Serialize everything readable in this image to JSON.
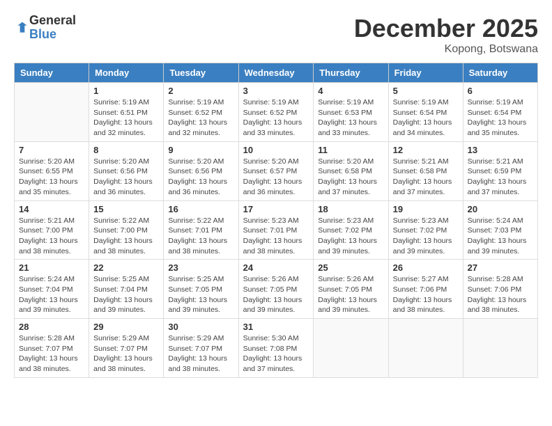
{
  "logo": {
    "general": "General",
    "blue": "Blue"
  },
  "title": "December 2025",
  "location": "Kopong, Botswana",
  "days_of_week": [
    "Sunday",
    "Monday",
    "Tuesday",
    "Wednesday",
    "Thursday",
    "Friday",
    "Saturday"
  ],
  "weeks": [
    [
      {
        "day": "",
        "info": ""
      },
      {
        "day": "1",
        "info": "Sunrise: 5:19 AM\nSunset: 6:51 PM\nDaylight: 13 hours\nand 32 minutes."
      },
      {
        "day": "2",
        "info": "Sunrise: 5:19 AM\nSunset: 6:52 PM\nDaylight: 13 hours\nand 32 minutes."
      },
      {
        "day": "3",
        "info": "Sunrise: 5:19 AM\nSunset: 6:52 PM\nDaylight: 13 hours\nand 33 minutes."
      },
      {
        "day": "4",
        "info": "Sunrise: 5:19 AM\nSunset: 6:53 PM\nDaylight: 13 hours\nand 33 minutes."
      },
      {
        "day": "5",
        "info": "Sunrise: 5:19 AM\nSunset: 6:54 PM\nDaylight: 13 hours\nand 34 minutes."
      },
      {
        "day": "6",
        "info": "Sunrise: 5:19 AM\nSunset: 6:54 PM\nDaylight: 13 hours\nand 35 minutes."
      }
    ],
    [
      {
        "day": "7",
        "info": "Sunrise: 5:20 AM\nSunset: 6:55 PM\nDaylight: 13 hours\nand 35 minutes."
      },
      {
        "day": "8",
        "info": "Sunrise: 5:20 AM\nSunset: 6:56 PM\nDaylight: 13 hours\nand 36 minutes."
      },
      {
        "day": "9",
        "info": "Sunrise: 5:20 AM\nSunset: 6:56 PM\nDaylight: 13 hours\nand 36 minutes."
      },
      {
        "day": "10",
        "info": "Sunrise: 5:20 AM\nSunset: 6:57 PM\nDaylight: 13 hours\nand 36 minutes."
      },
      {
        "day": "11",
        "info": "Sunrise: 5:20 AM\nSunset: 6:58 PM\nDaylight: 13 hours\nand 37 minutes."
      },
      {
        "day": "12",
        "info": "Sunrise: 5:21 AM\nSunset: 6:58 PM\nDaylight: 13 hours\nand 37 minutes."
      },
      {
        "day": "13",
        "info": "Sunrise: 5:21 AM\nSunset: 6:59 PM\nDaylight: 13 hours\nand 37 minutes."
      }
    ],
    [
      {
        "day": "14",
        "info": "Sunrise: 5:21 AM\nSunset: 7:00 PM\nDaylight: 13 hours\nand 38 minutes."
      },
      {
        "day": "15",
        "info": "Sunrise: 5:22 AM\nSunset: 7:00 PM\nDaylight: 13 hours\nand 38 minutes."
      },
      {
        "day": "16",
        "info": "Sunrise: 5:22 AM\nSunset: 7:01 PM\nDaylight: 13 hours\nand 38 minutes."
      },
      {
        "day": "17",
        "info": "Sunrise: 5:23 AM\nSunset: 7:01 PM\nDaylight: 13 hours\nand 38 minutes."
      },
      {
        "day": "18",
        "info": "Sunrise: 5:23 AM\nSunset: 7:02 PM\nDaylight: 13 hours\nand 39 minutes."
      },
      {
        "day": "19",
        "info": "Sunrise: 5:23 AM\nSunset: 7:02 PM\nDaylight: 13 hours\nand 39 minutes."
      },
      {
        "day": "20",
        "info": "Sunrise: 5:24 AM\nSunset: 7:03 PM\nDaylight: 13 hours\nand 39 minutes."
      }
    ],
    [
      {
        "day": "21",
        "info": "Sunrise: 5:24 AM\nSunset: 7:04 PM\nDaylight: 13 hours\nand 39 minutes."
      },
      {
        "day": "22",
        "info": "Sunrise: 5:25 AM\nSunset: 7:04 PM\nDaylight: 13 hours\nand 39 minutes."
      },
      {
        "day": "23",
        "info": "Sunrise: 5:25 AM\nSunset: 7:05 PM\nDaylight: 13 hours\nand 39 minutes."
      },
      {
        "day": "24",
        "info": "Sunrise: 5:26 AM\nSunset: 7:05 PM\nDaylight: 13 hours\nand 39 minutes."
      },
      {
        "day": "25",
        "info": "Sunrise: 5:26 AM\nSunset: 7:05 PM\nDaylight: 13 hours\nand 39 minutes."
      },
      {
        "day": "26",
        "info": "Sunrise: 5:27 AM\nSunset: 7:06 PM\nDaylight: 13 hours\nand 38 minutes."
      },
      {
        "day": "27",
        "info": "Sunrise: 5:28 AM\nSunset: 7:06 PM\nDaylight: 13 hours\nand 38 minutes."
      }
    ],
    [
      {
        "day": "28",
        "info": "Sunrise: 5:28 AM\nSunset: 7:07 PM\nDaylight: 13 hours\nand 38 minutes."
      },
      {
        "day": "29",
        "info": "Sunrise: 5:29 AM\nSunset: 7:07 PM\nDaylight: 13 hours\nand 38 minutes."
      },
      {
        "day": "30",
        "info": "Sunrise: 5:29 AM\nSunset: 7:07 PM\nDaylight: 13 hours\nand 38 minutes."
      },
      {
        "day": "31",
        "info": "Sunrise: 5:30 AM\nSunset: 7:08 PM\nDaylight: 13 hours\nand 37 minutes."
      },
      {
        "day": "",
        "info": ""
      },
      {
        "day": "",
        "info": ""
      },
      {
        "day": "",
        "info": ""
      }
    ]
  ]
}
